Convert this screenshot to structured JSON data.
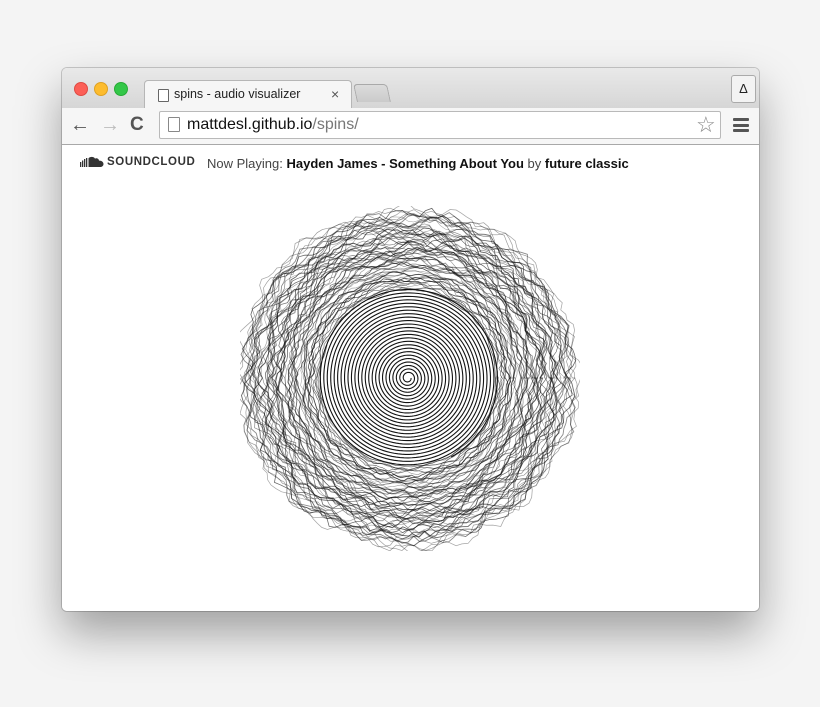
{
  "browser": {
    "tab": {
      "title": "spins - audio visualizer",
      "close_glyph": "×"
    },
    "profile_button": "Δ",
    "nav": {
      "back_glyph": "←",
      "forward_glyph": "→",
      "reload_glyph": "C"
    },
    "address": {
      "host": "mattdesl.github.io",
      "path": "/spins/"
    },
    "bookmark_glyph": "☆"
  },
  "page": {
    "logo_text": "SOUNDCLOUD",
    "now_playing": {
      "prefix": "Now Playing:",
      "track": "Hayden James - Something About You",
      "by": "by",
      "artist": "future classic"
    }
  },
  "icons": {
    "window_close": "traffic-light-red",
    "window_minimize": "traffic-light-yellow",
    "window_zoom": "traffic-light-green",
    "tab_page": "page-icon",
    "menu": "hamburger-icon",
    "logo": "soundcloud-cloud-icon"
  },
  "colors": {
    "traffic_red": "#fc5f57",
    "traffic_yellow": "#fdbc2e",
    "traffic_green": "#33c748",
    "visualizer_stroke": "#111111"
  }
}
